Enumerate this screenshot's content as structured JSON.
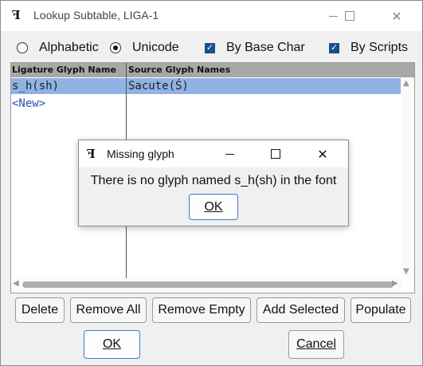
{
  "window": {
    "title": "Lookup Subtable, LIGA-1",
    "minimize_glyph": "—",
    "close_glyph": "✕"
  },
  "options": {
    "alphabetic": {
      "label": "Alphabetic",
      "selected": false
    },
    "unicode": {
      "label": "Unicode",
      "selected": true
    },
    "by_base_char": {
      "label": "By Base Char",
      "checked": true
    },
    "by_scripts": {
      "label": "By Scripts",
      "checked": true
    }
  },
  "table": {
    "columns": [
      "Ligature Glyph Name",
      "Source Glyph Names"
    ],
    "rows": [
      {
        "ligature": "s_h(sh)",
        "source": "Sacute(Ś)",
        "selected": true
      },
      {
        "ligature": "<New>",
        "source": "",
        "selected": false
      }
    ]
  },
  "buttons": {
    "delete": "Delete",
    "remove_all": "Remove All",
    "remove_empty": "Remove Empty",
    "add_selected": "Add Selected",
    "populate": "Populate",
    "ok": "OK",
    "cancel": "Cancel"
  },
  "dialog": {
    "title": "Missing glyph",
    "message": "There is no glyph named s_h(sh) in the font",
    "ok": "OK"
  },
  "icons": {
    "app": "fontforge-icon",
    "minimize": "minimize-icon",
    "maximize": "maximize-icon",
    "close": "close-icon"
  },
  "colors": {
    "selection": "#8fb3e3",
    "header": "#a8a8a8",
    "checkbox": "#1a4d8c",
    "new_link": "#2a4fb5"
  }
}
